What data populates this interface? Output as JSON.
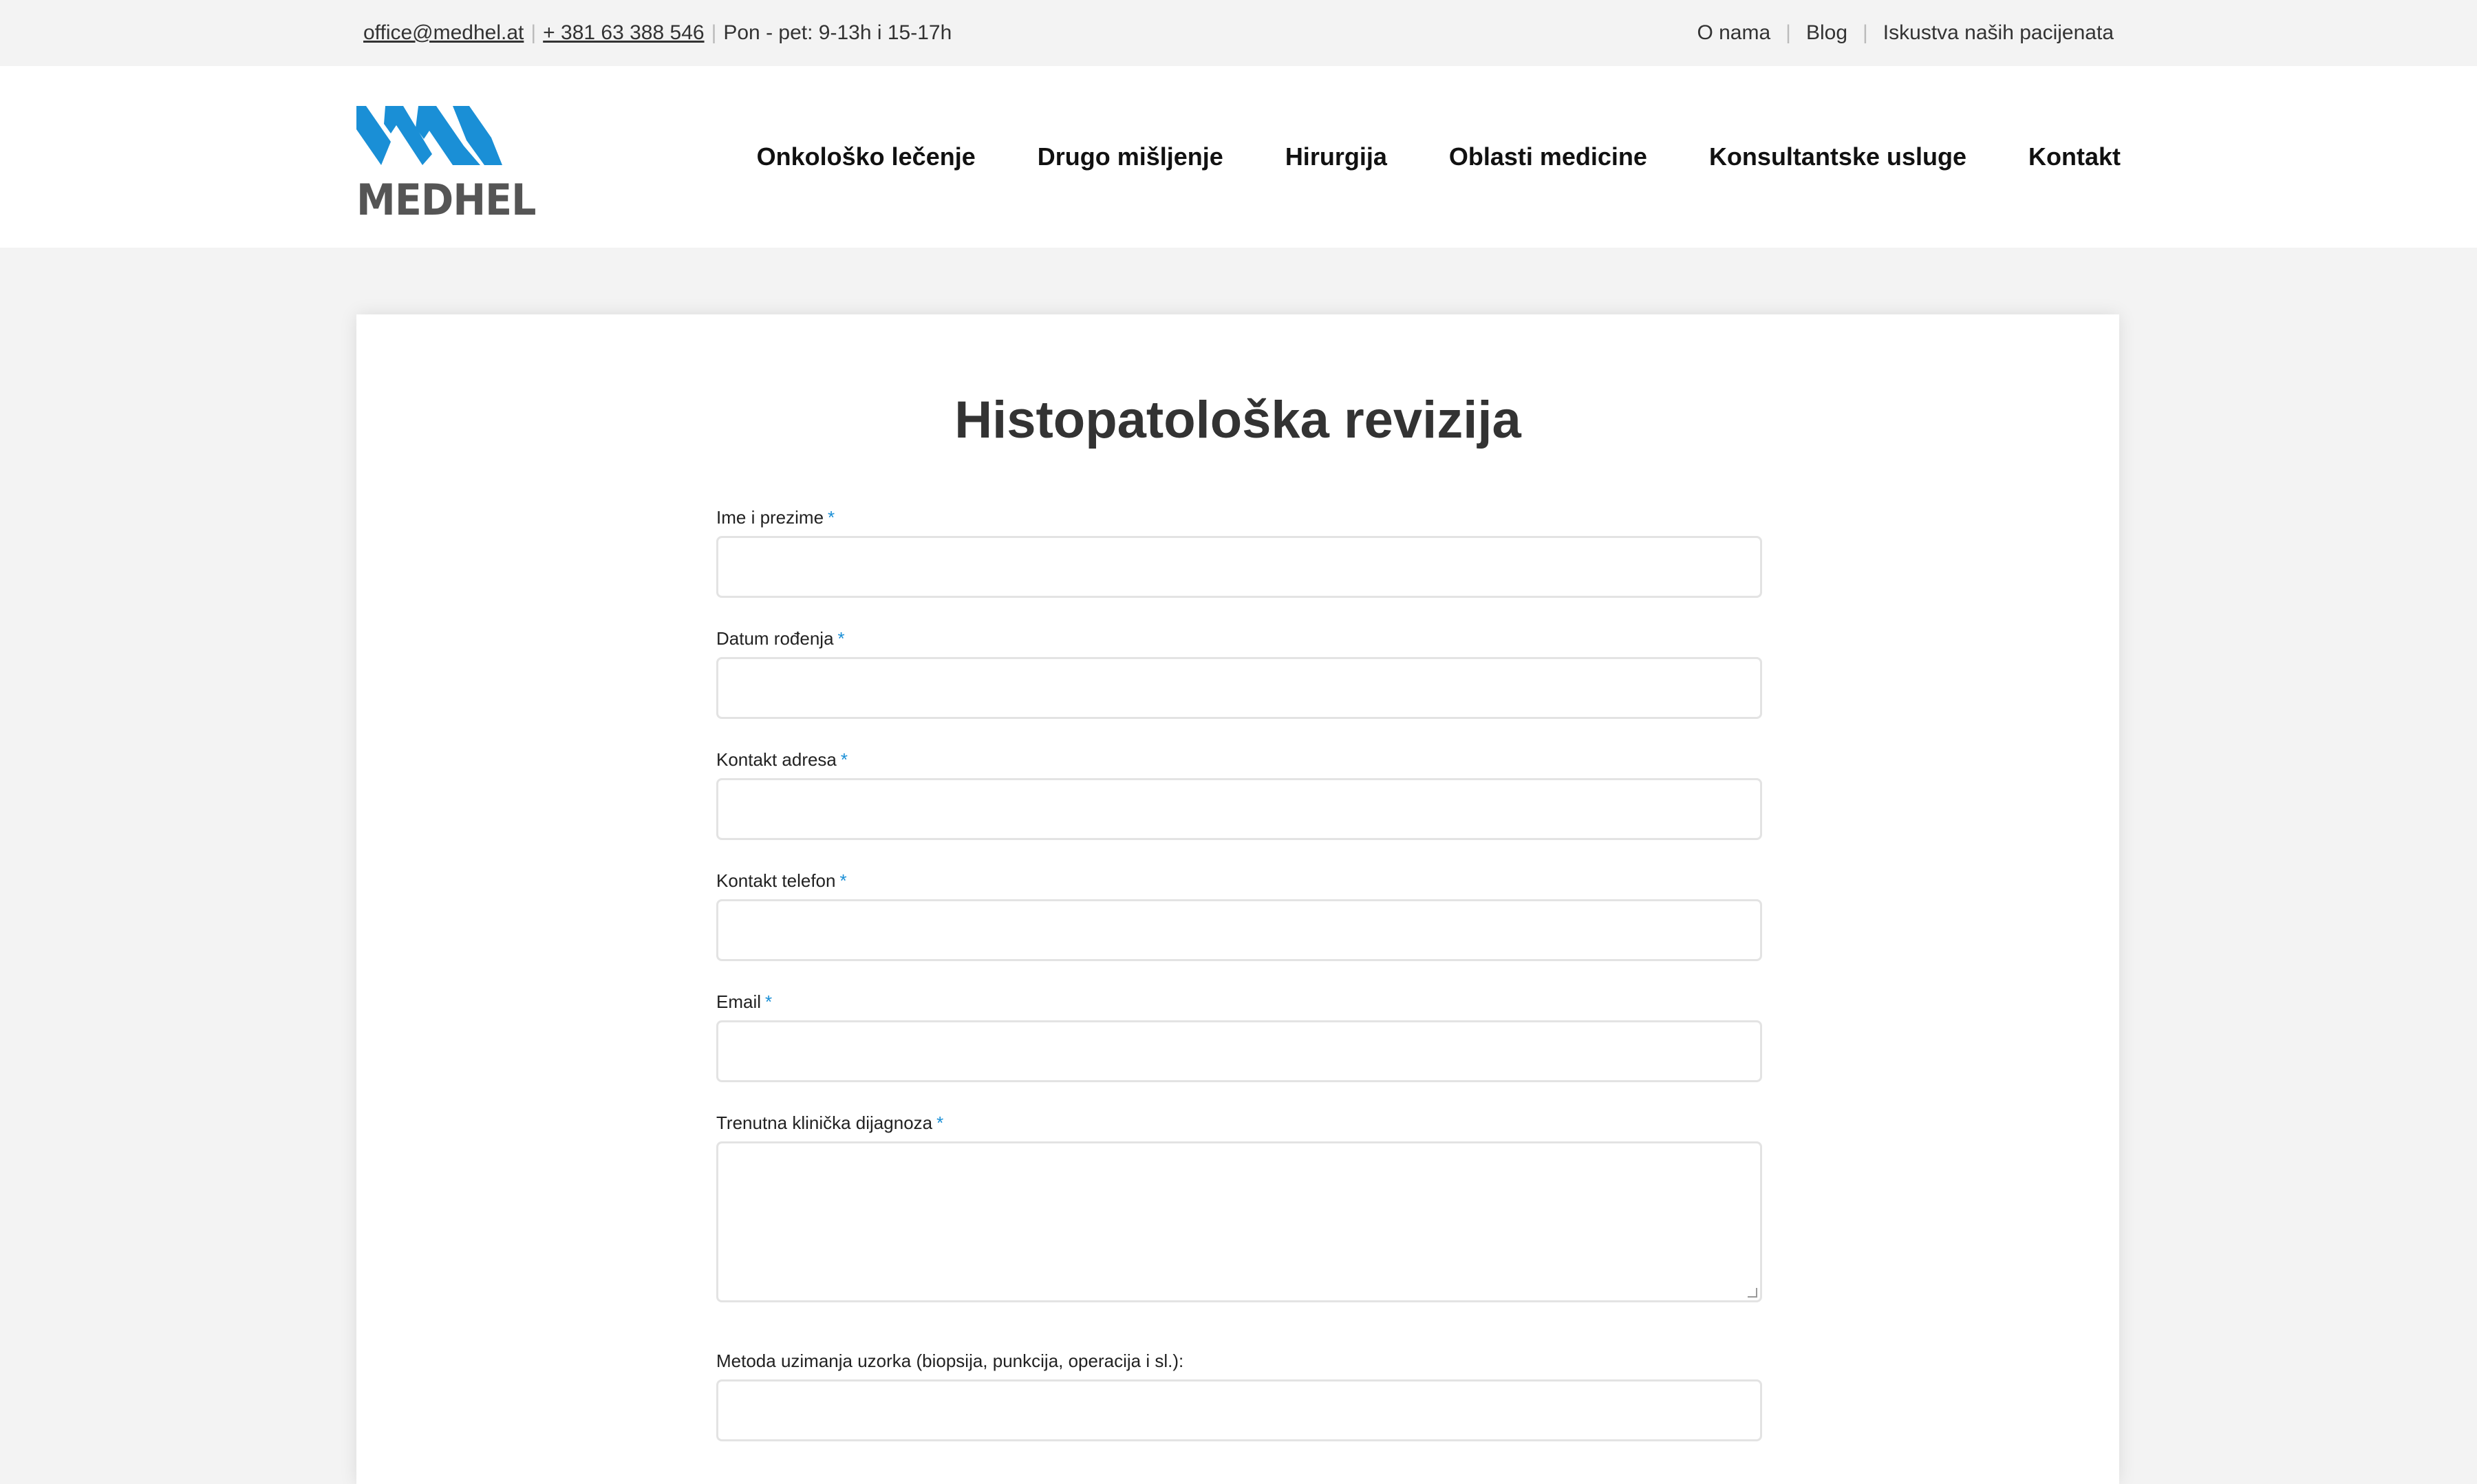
{
  "topbar": {
    "email": "office@medhel.at",
    "phone": "+ 381 63 388 546",
    "hours": "Pon - pet: 9-13h i 15-17h",
    "links": [
      "O nama",
      "Blog",
      "Iskustva naših pacijenata"
    ]
  },
  "logo": {
    "text": "MEDHEL",
    "color": "#1a8fd6"
  },
  "nav": [
    "Onkološko lečenje",
    "Drugo mišljenje",
    "Hirurgija",
    "Oblasti medicine",
    "Konsultantske usluge",
    "Kontakt"
  ],
  "page": {
    "title": "Histopatološka revizija"
  },
  "form": {
    "required_marker": "*",
    "fields": [
      {
        "label": "Ime i prezime",
        "value": ""
      },
      {
        "label": "Datum rođenja",
        "value": ""
      },
      {
        "label": "Kontakt adresa",
        "value": ""
      },
      {
        "label": "Kontakt telefon",
        "value": ""
      },
      {
        "label": "Email",
        "value": ""
      },
      {
        "label": "Trenutna klinička dijagnoza",
        "value": ""
      },
      {
        "label": "Metoda uzimanja uzorka (biopsija, punkcija, operacija i sl.):",
        "value": ""
      }
    ]
  }
}
